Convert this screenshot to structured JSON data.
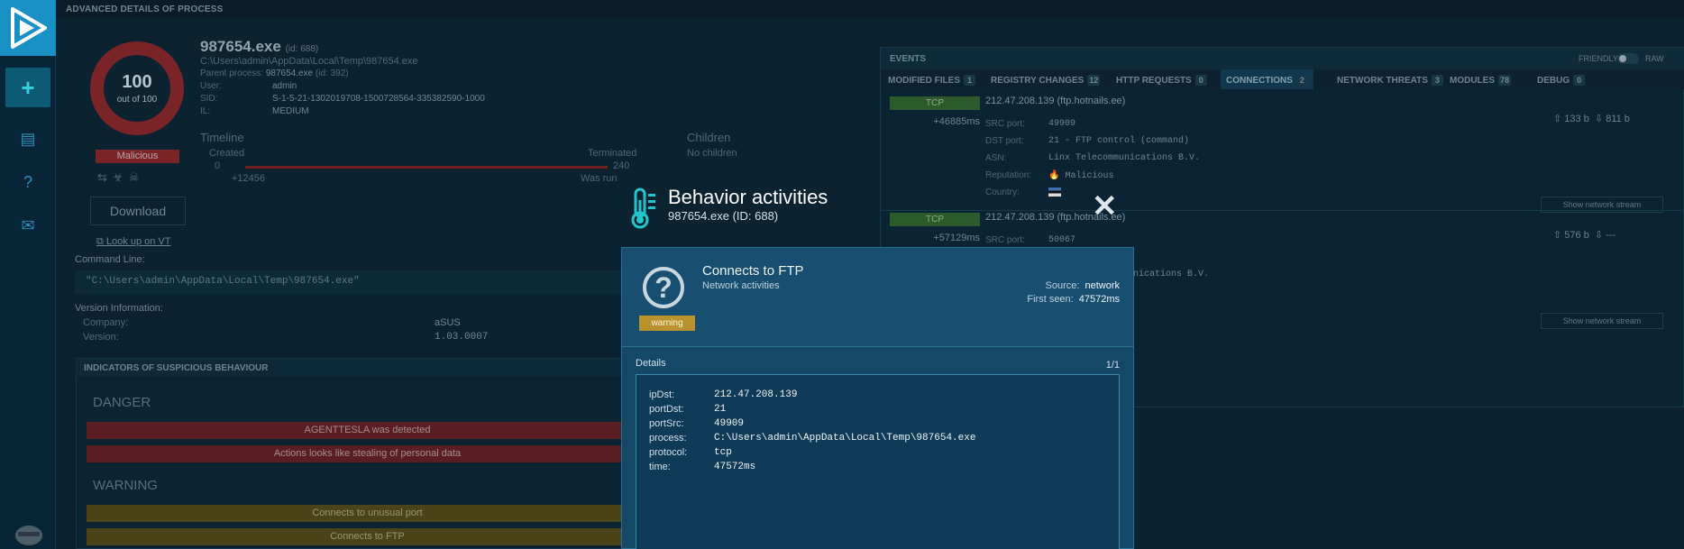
{
  "header": {
    "title": "ADVANCED DETAILS OF PROCESS"
  },
  "sidebar": {
    "items": [
      {
        "name": "new-task",
        "icon": "plus-icon",
        "glyph": "+"
      },
      {
        "name": "reports",
        "icon": "document-icon",
        "glyph": "▤"
      },
      {
        "name": "help",
        "icon": "help-icon",
        "glyph": "?"
      },
      {
        "name": "contact",
        "icon": "mail-icon",
        "glyph": "✉"
      }
    ]
  },
  "process": {
    "score": "100",
    "score_sub": "out of 100",
    "verdict": "Malicious",
    "download_label": "Download",
    "vt_label": "Look up on VT",
    "name": "987654.exe",
    "id_label": "(id: 688)",
    "path": "C:\\Users\\admin\\AppData\\Local\\Temp\\987654.exe",
    "parent_label": "Parent process:",
    "parent_name": "987654.exe",
    "parent_id": "(id: 392)",
    "user_label": "User:",
    "user": "admin",
    "sid_label": "SID:",
    "sid": "S-1-5-21-1302019708-1500728564-335382590-1000",
    "il_label": "IL:",
    "il": "MEDIUM"
  },
  "timeline": {
    "title": "Timeline",
    "created_label": "Created",
    "created_value": "0",
    "terminated_label": "Terminated",
    "terminated_value": "240",
    "start_offset": "+12456",
    "was_run": "Was run",
    "children_title": "Children",
    "children_value": "No children"
  },
  "command_line": {
    "label": "Command Line:",
    "value": "\"C:\\Users\\admin\\AppData\\Local\\Temp\\987654.exe\""
  },
  "version": {
    "label": "Version Information:",
    "company_label": "Company:",
    "company": "aSUS",
    "version_label": "Version:",
    "version": "1.03.0007"
  },
  "indicators": {
    "title": "INDICATORS OF SUSPICIOUS BEHAVIOUR",
    "danger_label": "DANGER",
    "danger": [
      "AGENTTESLA was detected",
      "Actions looks like stealing of personal data"
    ],
    "warning_label": "WARNING",
    "warning": [
      "Connects to unusual port",
      "Connects to FTP"
    ]
  },
  "events": {
    "title": "EVENTS",
    "mode_friendly": "FRIENDLY",
    "mode_raw": "RAW",
    "tabs": [
      {
        "label": "MODIFIED FILES",
        "count": "1"
      },
      {
        "label": "REGISTRY CHANGES",
        "count": "12"
      },
      {
        "label": "HTTP REQUESTS",
        "count": "0"
      },
      {
        "label": "CONNECTIONS",
        "count": "2"
      },
      {
        "label": "NETWORK THREATS",
        "count": "3"
      },
      {
        "label": "MODULES",
        "count": "78"
      },
      {
        "label": "DEBUG",
        "count": "0"
      }
    ],
    "connections": [
      {
        "protocol": "TCP",
        "time": "+46885ms",
        "host": "212.47.208.139 (ftp.hotnails.ee)",
        "src_label": "SRC port:",
        "src_port": "49909",
        "dst_label": "DST port:",
        "dst_port": "21 - FTP control (command)",
        "asn_label": "ASN:",
        "asn": "Linx Telecommunications B.V.",
        "rep_label": "Reputation:",
        "reputation": "Malicious",
        "country_label": "Country:",
        "upload": "133 b",
        "download": "811 b",
        "stream_label": "Show network stream"
      },
      {
        "protocol": "TCP",
        "time": "+57129ms",
        "host": "212.47.208.139 (ftp.hotnails.ee)",
        "src_label": "SRC port:",
        "src_port": "50067",
        "asn_tail": "nications B.V.",
        "upload": "576 b",
        "download": "---",
        "stream_label": "Show network stream"
      }
    ]
  },
  "behavior": {
    "title": "Behavior activities",
    "subtitle": "987654.exe (ID: 688)",
    "card": {
      "title": "Connects to FTP",
      "category": "Network activities",
      "badge": "warning",
      "source_label": "Source:",
      "source": "network",
      "first_seen_label": "First seen:",
      "first_seen": "47572ms",
      "details_label": "Details",
      "page": "1/1",
      "details": [
        {
          "key": "ipDst:",
          "value": "212.47.208.139"
        },
        {
          "key": "portDst:",
          "value": "21"
        },
        {
          "key": "portSrc:",
          "value": "49909"
        },
        {
          "key": "process:",
          "value": "C:\\Users\\admin\\AppData\\Local\\Temp\\987654.exe"
        },
        {
          "key": "protocol:",
          "value": "tcp"
        },
        {
          "key": "time:",
          "value": "47572ms"
        }
      ]
    }
  },
  "colors": {
    "accent": "#1990c4",
    "danger": "#7b2428",
    "warning_badge": "#b8922c",
    "tcp": "#2d5a2a"
  }
}
